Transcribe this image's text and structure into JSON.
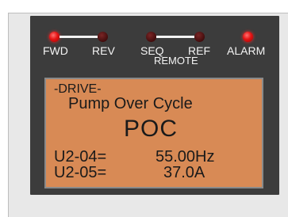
{
  "indicators": {
    "fwd": {
      "label": "FWD",
      "state": "on"
    },
    "rev": {
      "label": "REV",
      "state": "off"
    },
    "seq": {
      "label": "SEQ",
      "state": "off"
    },
    "ref": {
      "label": "REF",
      "state": "off"
    },
    "remote_label": "REMOTE",
    "alarm": {
      "label": "ALARM",
      "state": "on"
    }
  },
  "display": {
    "mode": "-DRIVE-",
    "fault_description": "Pump Over Cycle",
    "fault_code": "POC",
    "monitors": [
      {
        "param": "U2-04=",
        "value": "55.00Hz"
      },
      {
        "param": "U2-05=",
        "value": "37.0A"
      }
    ]
  },
  "colors": {
    "lcd_background": "#d88a55",
    "bezel": "#3c3c3c",
    "led_on": "#e51515",
    "led_off": "#4a1010"
  }
}
